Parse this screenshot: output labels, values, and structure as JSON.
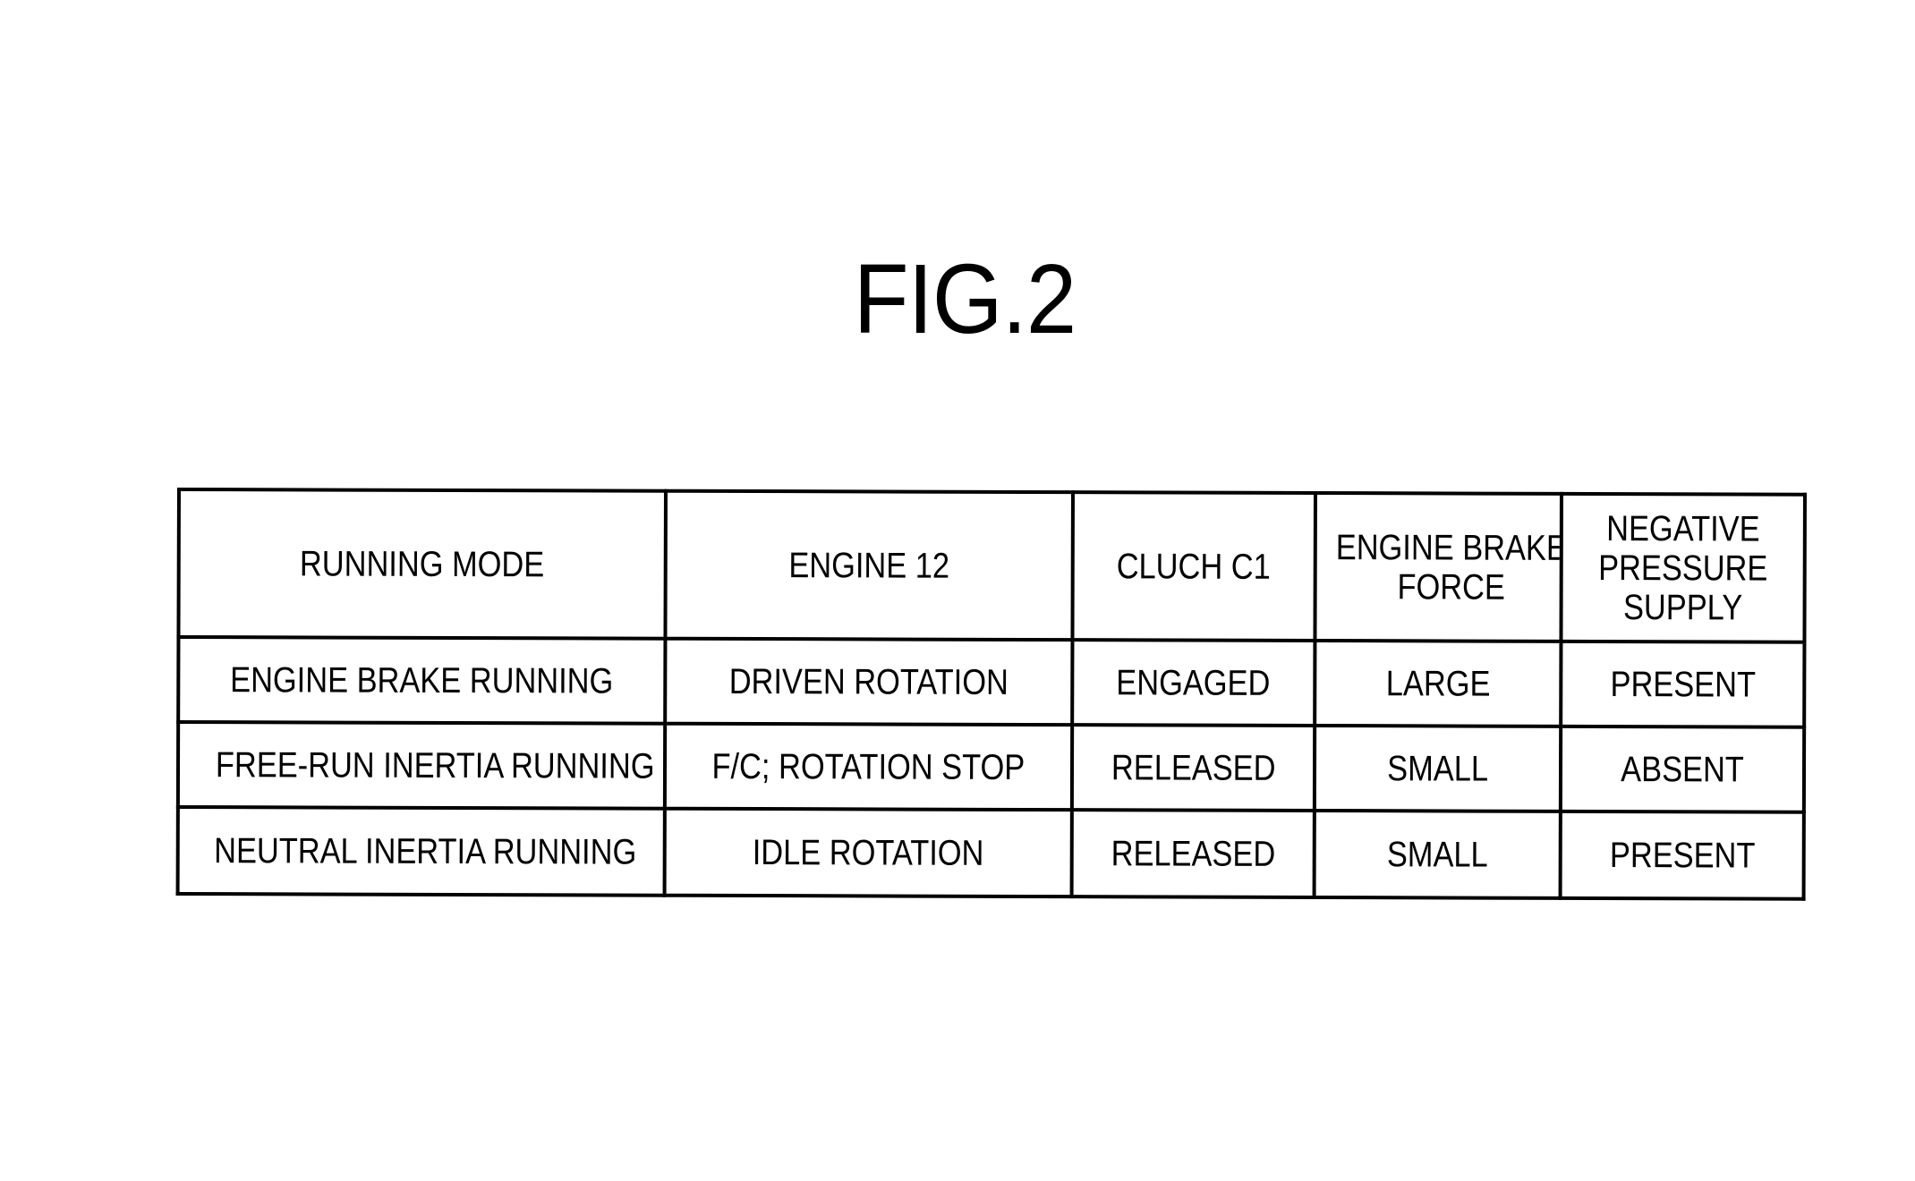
{
  "figure": {
    "title": "FIG.2"
  },
  "table": {
    "headers": [
      {
        "lines": [
          "RUNNING MODE"
        ]
      },
      {
        "lines": [
          "ENGINE 12"
        ]
      },
      {
        "lines": [
          "CLUCH C1"
        ]
      },
      {
        "lines": [
          "ENGINE BRAKE",
          "FORCE"
        ]
      },
      {
        "lines": [
          "NEGATIVE",
          "PRESSURE",
          "SUPPLY"
        ]
      }
    ],
    "rows": [
      [
        "ENGINE BRAKE RUNNING",
        "DRIVEN ROTATION",
        "ENGAGED",
        "LARGE",
        "PRESENT"
      ],
      [
        "FREE-RUN INERTIA RUNNING",
        "F/C; ROTATION STOP",
        "RELEASED",
        "SMALL",
        "ABSENT"
      ],
      [
        "NEUTRAL INERTIA RUNNING",
        "IDLE ROTATION",
        "RELEASED",
        "SMALL",
        "PRESENT"
      ]
    ]
  }
}
